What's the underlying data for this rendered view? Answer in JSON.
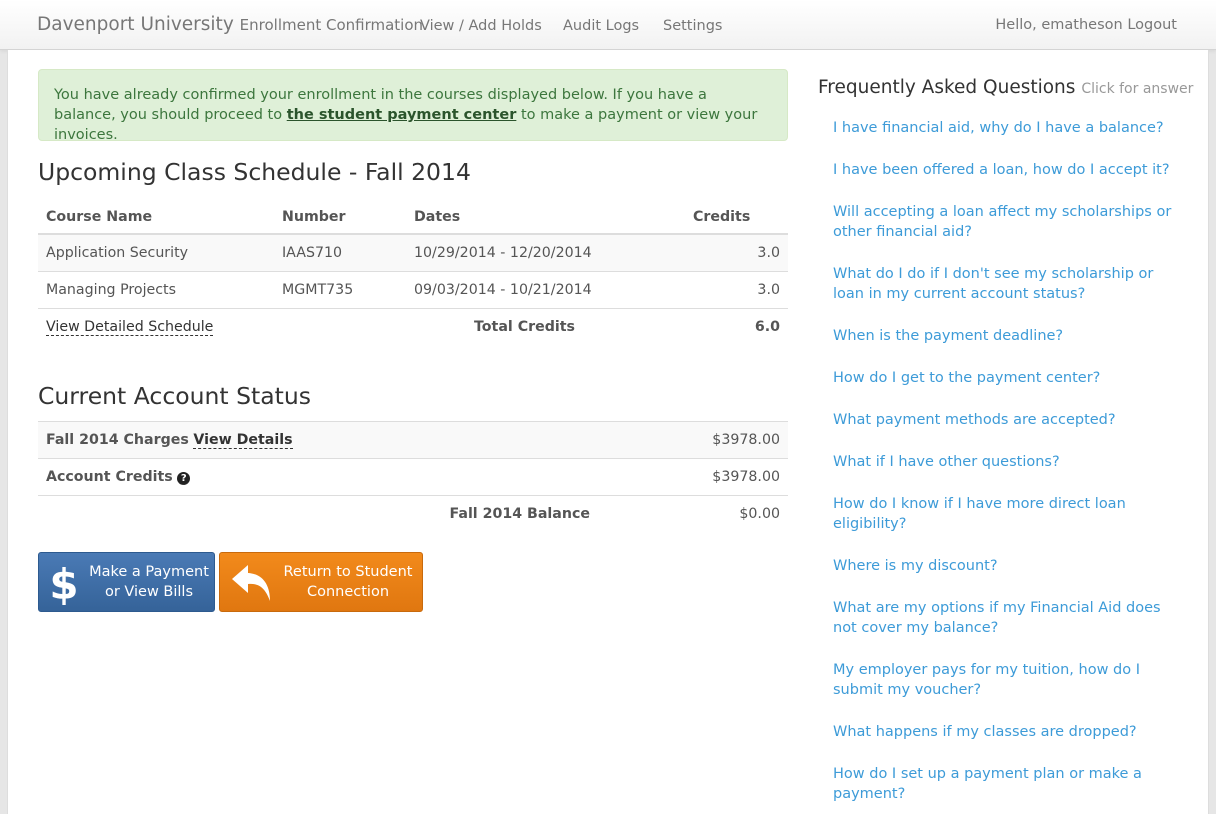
{
  "navbar": {
    "brand": "Davenport University",
    "title": "Enrollment Confirmation",
    "links": [
      "View / Add Holds",
      "Audit Logs",
      "Settings"
    ],
    "greeting": "Hello, ematheson",
    "logout": "Logout"
  },
  "alert": {
    "text_before": "You have already confirmed your enrollment in the courses displayed below. If you have a balance, you should proceed to ",
    "link": "the student payment center",
    "text_after": " to make a payment or view your invoices."
  },
  "schedule": {
    "heading": "Upcoming Class Schedule - Fall 2014",
    "columns": [
      "Course Name",
      "Number",
      "Dates",
      "Credits"
    ],
    "rows": [
      {
        "course": "Application Security",
        "number": "IAAS710",
        "dates": "10/29/2014 - 12/20/2014",
        "credits": "3.0"
      },
      {
        "course": "Managing Projects",
        "number": "MGMT735",
        "dates": "09/03/2014 - 10/21/2014",
        "credits": "3.0"
      }
    ],
    "view_detailed": "View Detailed Schedule",
    "total_label": "Total Credits",
    "total_value": "6.0"
  },
  "account": {
    "heading": "Current Account Status",
    "charges_label": "Fall 2014 Charges",
    "view_details": "View Details",
    "charges_value": "$3978.00",
    "credits_label": "Account Credits",
    "help_glyph": "?",
    "credits_value": "$3978.00",
    "balance_label": "Fall 2014 Balance",
    "balance_value": "$0.00"
  },
  "buttons": {
    "pay_line1": "Make a Payment",
    "pay_line2": "or View Bills",
    "return_line1": "Return to Student",
    "return_line2": "Connection"
  },
  "faq": {
    "title": "Frequently Asked Questions",
    "hint": "Click for answer",
    "items": [
      "I have financial aid, why do I have a balance?",
      "I have been offered a loan, how do I accept it?",
      "Will accepting a loan affect my scholarships or other financial aid?",
      "What do I do if I don't see my scholarship or loan in my current account status?",
      "When is the payment deadline?",
      "How do I get to the payment center?",
      "What payment methods are accepted?",
      "What if I have other questions?",
      "How do I know if I have more direct loan eligibility?",
      "Where is my discount?",
      "What are my options if my Financial Aid does not cover my balance?",
      "My employer pays for my tuition, how do I submit my voucher?",
      "What happens if my classes are dropped?",
      "How do I set up a payment plan or make a payment?"
    ]
  },
  "colors": {
    "accent_link": "#3d9bd8",
    "alert_bg": "#dff0d8",
    "pay_button": "#3f6ea7",
    "return_button": "#ea8116"
  }
}
